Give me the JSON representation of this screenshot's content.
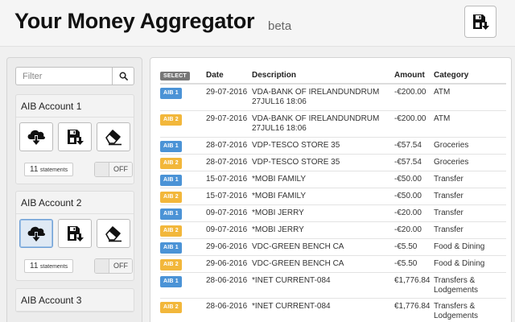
{
  "header": {
    "title": "Your Money Aggregator",
    "badge": "beta"
  },
  "sidebar": {
    "filter_placeholder": "Filter",
    "accounts": [
      {
        "name": "AIB Account 1",
        "statements_count": "11",
        "statements_label": "statements",
        "toggle": "OFF"
      },
      {
        "name": "AIB Account 2",
        "statements_count": "11",
        "statements_label": "statements",
        "toggle": "OFF"
      },
      {
        "name": "AIB Account 3"
      }
    ]
  },
  "table": {
    "headers": {
      "select": "SELECT",
      "date": "Date",
      "description": "Description",
      "amount": "Amount",
      "category": "Category"
    },
    "rows": [
      {
        "account": "AIB 1",
        "color": "blue",
        "date": "29-07-2016",
        "desc1": "VDA-BANK OF IRELANDUNDRUM",
        "desc2": "27JUL16 18:06",
        "amount": "-€200.00",
        "cat1": "ATM",
        "cat2": ""
      },
      {
        "account": "AIB 2",
        "color": "yellow",
        "date": "29-07-2016",
        "desc1": "VDA-BANK OF IRELANDUNDRUM",
        "desc2": "27JUL16 18:06",
        "amount": "-€200.00",
        "cat1": "ATM",
        "cat2": ""
      },
      {
        "account": "AIB 1",
        "color": "blue",
        "date": "28-07-2016",
        "desc1": "VDP-TESCO STORE 35",
        "desc2": "",
        "amount": "-€57.54",
        "cat1": "Groceries",
        "cat2": ""
      },
      {
        "account": "AIB 2",
        "color": "yellow",
        "date": "28-07-2016",
        "desc1": "VDP-TESCO STORE 35",
        "desc2": "",
        "amount": "-€57.54",
        "cat1": "Groceries",
        "cat2": ""
      },
      {
        "account": "AIB 1",
        "color": "blue",
        "date": "15-07-2016",
        "desc1": "*MOBI FAMILY",
        "desc2": "",
        "amount": "-€50.00",
        "cat1": "Transfer",
        "cat2": ""
      },
      {
        "account": "AIB 2",
        "color": "yellow",
        "date": "15-07-2016",
        "desc1": "*MOBI FAMILY",
        "desc2": "",
        "amount": "-€50.00",
        "cat1": "Transfer",
        "cat2": ""
      },
      {
        "account": "AIB 1",
        "color": "blue",
        "date": "09-07-2016",
        "desc1": "*MOBI JERRY",
        "desc2": "",
        "amount": "-€20.00",
        "cat1": "Transfer",
        "cat2": ""
      },
      {
        "account": "AIB 2",
        "color": "yellow",
        "date": "09-07-2016",
        "desc1": "*MOBI JERRY",
        "desc2": "",
        "amount": "-€20.00",
        "cat1": "Transfer",
        "cat2": ""
      },
      {
        "account": "AIB 1",
        "color": "blue",
        "date": "29-06-2016",
        "desc1": "VDC-GREEN BENCH CA",
        "desc2": "",
        "amount": "-€5.50",
        "cat1": "Food & Dining",
        "cat2": ""
      },
      {
        "account": "AIB 2",
        "color": "yellow",
        "date": "29-06-2016",
        "desc1": "VDC-GREEN BENCH CA",
        "desc2": "",
        "amount": "-€5.50",
        "cat1": "Food & Dining",
        "cat2": ""
      },
      {
        "account": "AIB 1",
        "color": "blue",
        "date": "28-06-2016",
        "desc1": "*INET CURRENT-084",
        "desc2": "",
        "amount": "€1,776.84",
        "cat1": "Transfers &",
        "cat2": "Lodgements"
      },
      {
        "account": "AIB 2",
        "color": "yellow",
        "date": "28-06-2016",
        "desc1": "*INET CURRENT-084",
        "desc2": "",
        "amount": "€1,776.84",
        "cat1": "Transfers &",
        "cat2": "Lodgements"
      }
    ]
  },
  "colors": {
    "account_1_tag": "#4b93d6",
    "account_2_tag": "#f2b73b",
    "select_button": "#777777",
    "active_button_border": "#6fa0d6"
  },
  "icons": {
    "save": "floppy-disk-download-icon",
    "search": "search-icon",
    "download": "cloud-download-icon",
    "export": "floppy-disk-download-icon",
    "clear": "eraser-icon"
  }
}
